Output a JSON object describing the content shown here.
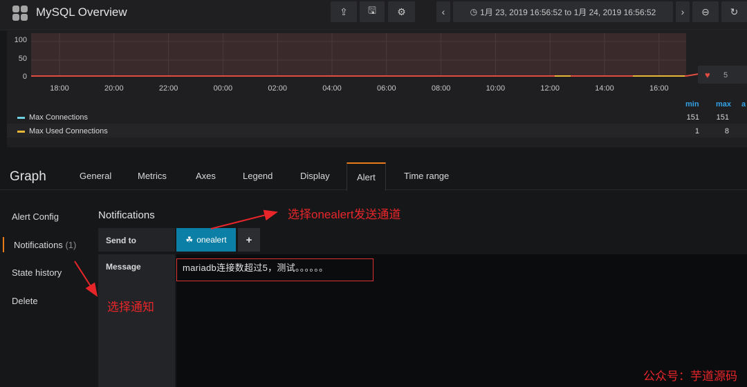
{
  "header": {
    "title": "MySQL Overview",
    "time_range": "1月 23, 2019 16:56:52 to 1月 24, 2019 16:56:52",
    "icons": [
      "grid-logo-icon",
      "share-icon",
      "save-icon",
      "gear-icon",
      "chevron-left-icon",
      "clock-icon",
      "chevron-right-icon",
      "zoom-out-icon",
      "refresh-icon"
    ]
  },
  "graph": {
    "y_ticks": [
      "100",
      "50",
      "0"
    ],
    "x_ticks": [
      "18:00",
      "20:00",
      "22:00",
      "00:00",
      "02:00",
      "04:00",
      "06:00",
      "08:00",
      "10:00",
      "12:00",
      "14:00",
      "16:00"
    ],
    "threshold_value": "5",
    "threshold_color": "#e24d42",
    "legend_headers": [
      "min",
      "max",
      "a"
    ],
    "legend": [
      {
        "name": "Max Connections",
        "color": "#6ed0e0",
        "min": "151",
        "max": "151"
      },
      {
        "name": "Max Used Connections",
        "color": "#eab839",
        "min": "1",
        "max": "8"
      }
    ]
  },
  "editor": {
    "title": "Graph",
    "tabs": [
      "General",
      "Metrics",
      "Axes",
      "Legend",
      "Display",
      "Alert",
      "Time range"
    ],
    "active_tab": "Alert",
    "sidebar": [
      {
        "label": "Alert Config"
      },
      {
        "label": "Notifications",
        "count": "(1)"
      },
      {
        "label": "State history"
      },
      {
        "label": "Delete"
      }
    ],
    "section_title": "Notifications",
    "send_to_label": "Send to",
    "channel": "onealert",
    "add_label": "+",
    "message_label": "Message",
    "message_value": "mariadb连接数超过5，测试。。。。。。"
  },
  "annotations": {
    "channel_note": "选择onealert发送通道",
    "notify_note": "选择通知",
    "watermark": "公众号：芋道源码"
  },
  "colors": {
    "accent": "#eb7b18",
    "chip": "#0b7fa6",
    "annotation": "#e8262a"
  }
}
